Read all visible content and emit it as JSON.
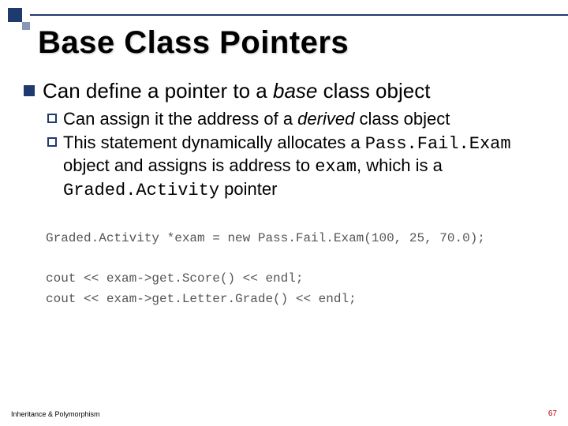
{
  "title": "Base Class Pointers",
  "bullet1": {
    "pre": "Can define a pointer to a ",
    "italic": "base",
    "post": " class object"
  },
  "sub1": {
    "pre": "Can assign it the address of a ",
    "italic": "derived",
    "post": " class object"
  },
  "sub2": {
    "part1": "This statement dynamically allocates a ",
    "code1": "Pass.Fail.Exam",
    "part2": " object and assigns is address to ",
    "code2": "exam",
    "part3": ", which is a ",
    "code3": "Graded.Activity",
    "part4": " pointer"
  },
  "code": "Graded.Activity *exam = new Pass.Fail.Exam(100, 25, 70.0);\n\ncout << exam->get.Score() << endl;\ncout << exam->get.Letter.Grade() << endl;",
  "footer_left": "Inheritance & Polymorphism",
  "footer_right": "67"
}
